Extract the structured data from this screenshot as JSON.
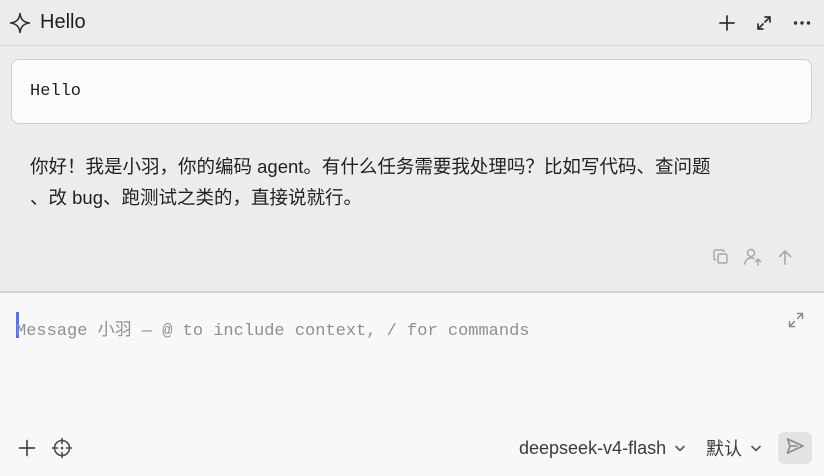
{
  "header": {
    "title": "Hello",
    "icons": {
      "title_icon": "sparkle-icon",
      "new": "plus-icon",
      "expand": "expand-icon",
      "more": "more-icon"
    }
  },
  "conversation": {
    "user_message": "Hello",
    "assistant_reply_line1": "你好！我是小羽，你的编码 agent。有什么任务需要我处理吗？比如写代码、查问题",
    "assistant_reply_line2": "、改 bug、跑测试之类的，直接说就行。",
    "message_actions": [
      "copy-icon",
      "user-arrow-icon",
      "arrow-up-icon"
    ]
  },
  "composer": {
    "placeholder": "Message 小羽 — @ to include context, / for commands",
    "model_name": "deepseek-v4-flash",
    "mode_name": "默认",
    "icons": {
      "expand": "expand-icon",
      "add": "plus-icon",
      "context": "crosshair-icon",
      "send": "send-icon"
    }
  },
  "colors": {
    "background": "#ececec",
    "composer_background": "#f8f8f8",
    "caret": "#5b6fd6",
    "placeholder": "#8f8f8f"
  }
}
